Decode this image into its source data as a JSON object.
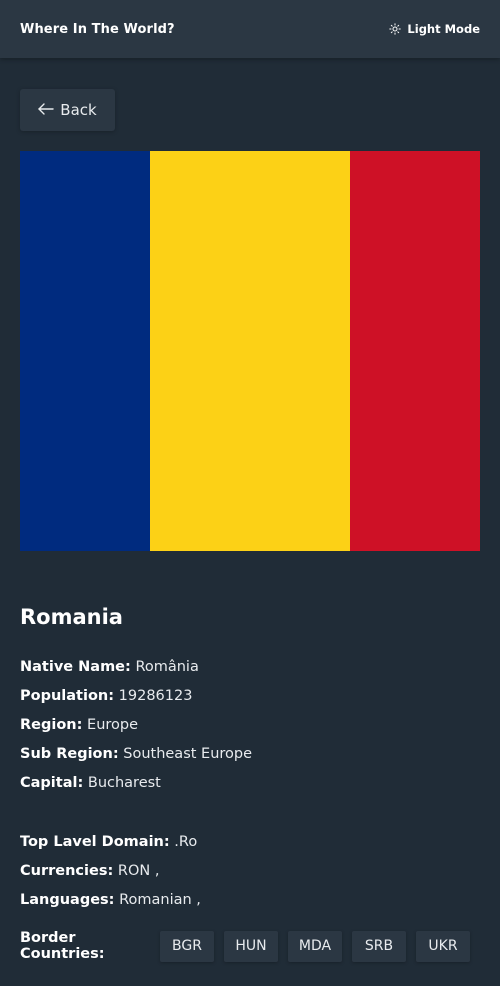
{
  "header": {
    "title": "Where In The World?",
    "mode_toggle_label": "Light Mode",
    "mode_icon": "sun-icon"
  },
  "back": {
    "label": "Back",
    "icon": "arrow-left-icon"
  },
  "flag": {
    "colors": [
      "#002b7f",
      "#fcd116",
      "#ce1126"
    ]
  },
  "country": {
    "name": "Romania",
    "native_name_label": "Native Name:",
    "native_name": "România",
    "population_label": "Population:",
    "population": "19286123",
    "region_label": "Region:",
    "region": "Europe",
    "sub_region_label": "Sub Region:",
    "sub_region": "Southeast Europe",
    "capital_label": "Capital:",
    "capital": "Bucharest",
    "tld_label": "Top Lavel Domain:",
    "tld": ".Ro",
    "currencies_label": "Currencies:",
    "currencies": "RON ,",
    "languages_label": "Languages:",
    "languages": "Romanian ,"
  },
  "borders": {
    "label": "Border Countries:",
    "items": [
      "BGR",
      "HUN",
      "MDA",
      "SRB",
      "UKR"
    ]
  },
  "colors": {
    "background": "#202c37",
    "elements": "#2b3743",
    "text": "#ffffff"
  }
}
